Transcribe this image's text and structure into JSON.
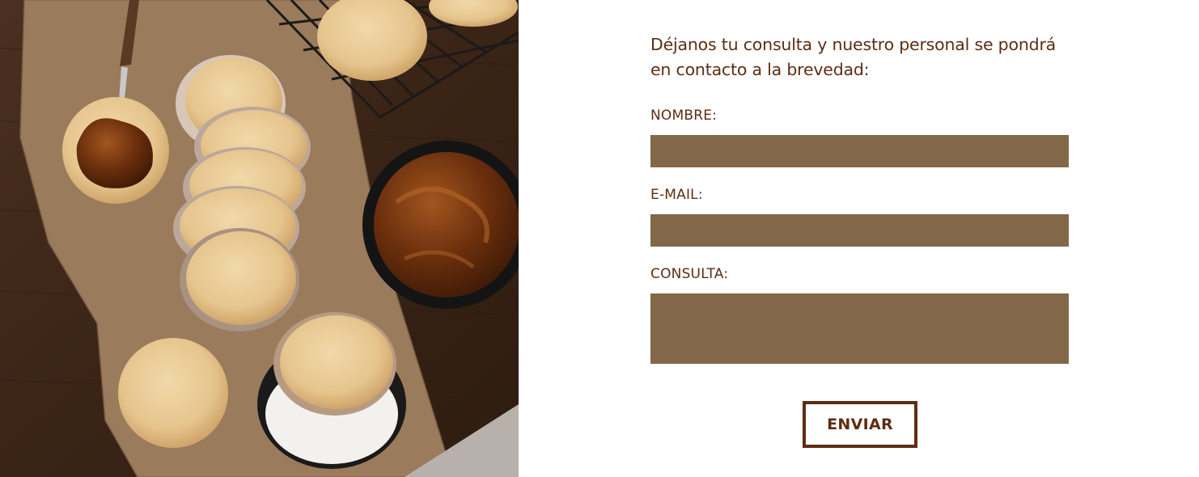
{
  "contact_form": {
    "intro_text": "Déjanos tu consulta y nuestro personal se pondrá en contacto a la brevedad:",
    "fields": [
      {
        "label": "NOMBRE:",
        "value": ""
      },
      {
        "label": "E-MAIL:",
        "value": ""
      },
      {
        "label": "CONSULTA:",
        "value": ""
      }
    ],
    "submit_label": "ENVIAR"
  },
  "colors": {
    "text": "#5e2d12",
    "field_background": "#826849",
    "button_border": "#5e2d12",
    "page_background": "#ffffff"
  },
  "photo": {
    "subject": "alfajores with dulce de leche and shredded coconut on a wooden table"
  }
}
